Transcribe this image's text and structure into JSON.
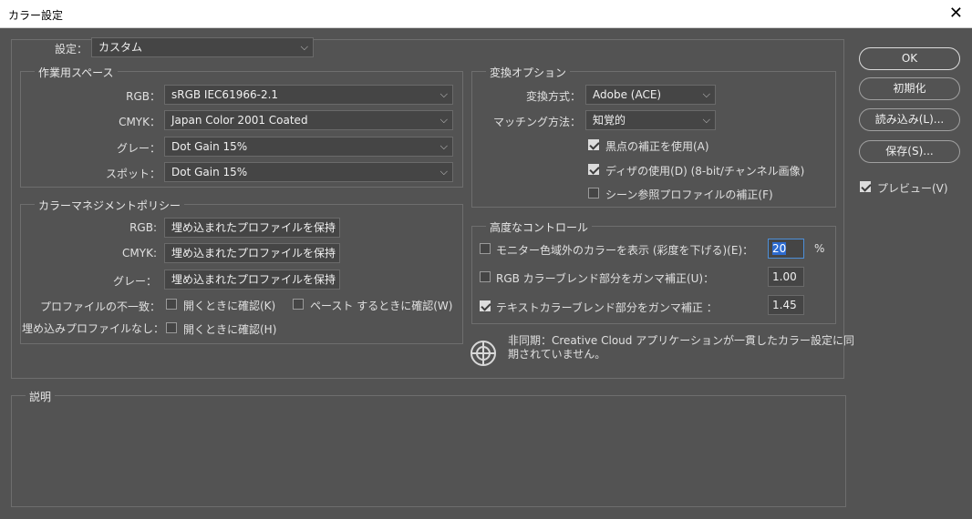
{
  "window": {
    "title": "カラー設定",
    "close_glyph": "✕"
  },
  "settings": {
    "label": "設定：",
    "value": "カスタム"
  },
  "workspace": {
    "title": "作業用スペース",
    "rows": [
      {
        "label": "RGB：",
        "value": "sRGB IEC61966-2.1"
      },
      {
        "label": "CMYK：",
        "value": "Japan Color 2001 Coated"
      },
      {
        "label": "グレー：",
        "value": "Dot Gain 15%"
      },
      {
        "label": "スポット：",
        "value": "Dot Gain 15%"
      }
    ]
  },
  "policy": {
    "title": "カラーマネジメントポリシー",
    "rows": [
      {
        "label": "RGB:",
        "value": "埋め込まれたプロファイルを保持"
      },
      {
        "label": "CMYK:",
        "value": "埋め込まれたプロファイルを保持"
      },
      {
        "label": "グレー：",
        "value": "埋め込まれたプロファイルを保持"
      }
    ],
    "mismatch_label": "プロファイルの不一致：",
    "mismatch_open": "開くときに確認(K)",
    "mismatch_paste": "ペースト するときに確認(W)",
    "missing_label": "埋め込みプロファイルなし：",
    "missing_open": "開くときに確認(H)"
  },
  "conversion": {
    "title": "変換オプション",
    "engine_label": "変換方式：",
    "engine_value": "Adobe (ACE)",
    "intent_label": "マッチング方法：",
    "intent_value": "知覚的",
    "bpc": "黒点の補正を使用(A)",
    "bpc_checked": true,
    "dither": "ディザの使用(D) (8-bit/チャンネル画像)",
    "dither_checked": true,
    "scene": "シーン参照プロファイルの補正(F)",
    "scene_checked": false
  },
  "advanced": {
    "title": "高度なコントロール",
    "desaturate": "モニター色域外のカラーを表示 (彩度を下げる)(E)：",
    "desaturate_checked": false,
    "desaturate_value": "20",
    "desaturate_unit": "%",
    "blend_rgb": "RGB カラーブレンド部分をガンマ補正(U)：",
    "blend_rgb_checked": false,
    "blend_rgb_value": "1.00",
    "blend_text": "テキストカラーブレンド部分をガンマ補正 ：",
    "blend_text_checked": true,
    "blend_text_value": "1.45"
  },
  "sync": {
    "line1": "非同期：Creative Cloud アプリケーションが一貫したカラー設定に同",
    "line2": "期されていません。"
  },
  "description": {
    "title": "説明"
  },
  "buttons": {
    "ok": "OK",
    "defaults": "初期化",
    "load": "読み込み(L)...",
    "save": "保存(S)..."
  },
  "preview": {
    "label": "プレビュー(V)",
    "checked": true
  }
}
